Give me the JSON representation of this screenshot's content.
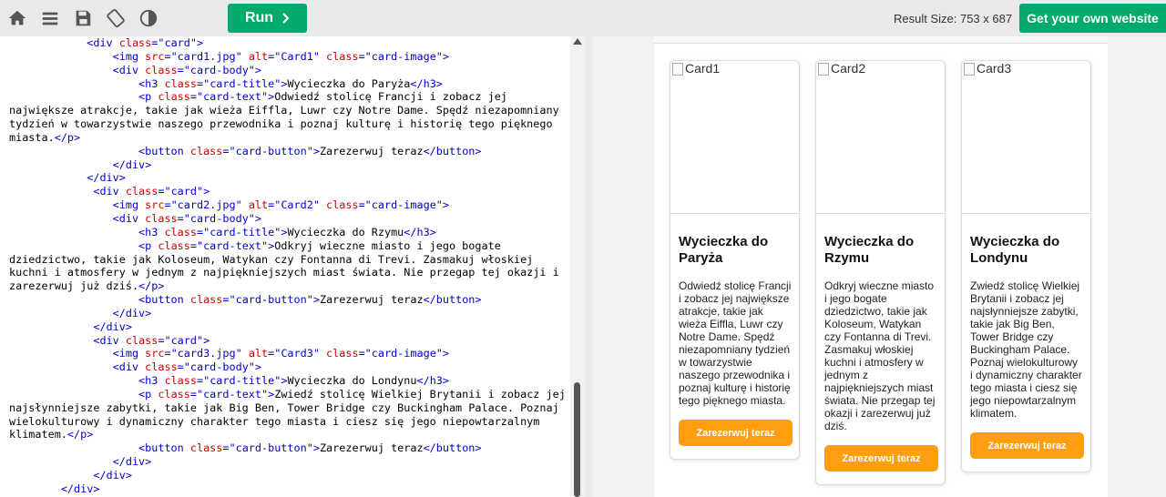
{
  "toolbar": {
    "run_label": "Run",
    "result_size_label": "Result Size: 753 x 687",
    "own_website_label": "Get your own website"
  },
  "editor": {
    "lines": [
      [
        {
          "t": "            ",
          "c": ""
        },
        {
          "t": "<div ",
          "c": "tag"
        },
        {
          "t": "class",
          "c": "attr"
        },
        {
          "t": "=\"card\"",
          "c": "val"
        },
        {
          "t": ">",
          "c": "tag"
        }
      ],
      [
        {
          "t": "                ",
          "c": ""
        },
        {
          "t": "<img ",
          "c": "tag"
        },
        {
          "t": "src",
          "c": "attr"
        },
        {
          "t": "=\"card1.jpg\" ",
          "c": "val"
        },
        {
          "t": "alt",
          "c": "attr"
        },
        {
          "t": "=\"Card1\" ",
          "c": "val"
        },
        {
          "t": "class",
          "c": "attr"
        },
        {
          "t": "=\"card-image\"",
          "c": "val"
        },
        {
          "t": ">",
          "c": "tag"
        }
      ],
      [
        {
          "t": "                ",
          "c": ""
        },
        {
          "t": "<div ",
          "c": "tag"
        },
        {
          "t": "class",
          "c": "attr"
        },
        {
          "t": "=\"card-body\"",
          "c": "val"
        },
        {
          "t": ">",
          "c": "tag"
        }
      ],
      [
        {
          "t": "                    ",
          "c": ""
        },
        {
          "t": "<h3 ",
          "c": "tag"
        },
        {
          "t": "class",
          "c": "attr"
        },
        {
          "t": "=\"card-title\"",
          "c": "val"
        },
        {
          "t": ">",
          "c": "tag"
        },
        {
          "t": "Wycieczka do Paryża",
          "c": ""
        },
        {
          "t": "</h3>",
          "c": "tag"
        }
      ],
      [
        {
          "t": "                    ",
          "c": ""
        },
        {
          "t": "<p ",
          "c": "tag"
        },
        {
          "t": "class",
          "c": "attr"
        },
        {
          "t": "=\"card-text\"",
          "c": "val"
        },
        {
          "t": ">",
          "c": "tag"
        },
        {
          "t": "Odwiedź stolicę Francji i zobacz jej",
          "c": ""
        }
      ],
      [
        {
          "t": "największe atrakcje, takie jak wieża Eiffla, Luwr czy Notre Dame. Spędź niezapomniany",
          "c": ""
        }
      ],
      [
        {
          "t": "tydzień w towarzystwie naszego przewodnika i poznaj kulturę i historię tego pięknego",
          "c": ""
        }
      ],
      [
        {
          "t": "miasta.",
          "c": ""
        },
        {
          "t": "</p>",
          "c": "tag"
        }
      ],
      [
        {
          "t": "                    ",
          "c": ""
        },
        {
          "t": "<button ",
          "c": "tag"
        },
        {
          "t": "class",
          "c": "attr"
        },
        {
          "t": "=\"card-button\"",
          "c": "val"
        },
        {
          "t": ">",
          "c": "tag"
        },
        {
          "t": "Zarezerwuj teraz",
          "c": ""
        },
        {
          "t": "</button>",
          "c": "tag"
        }
      ],
      [
        {
          "t": "                ",
          "c": ""
        },
        {
          "t": "</div>",
          "c": "tag"
        }
      ],
      [
        {
          "t": "            ",
          "c": ""
        },
        {
          "t": "</div>",
          "c": "tag"
        }
      ],
      [
        {
          "t": "             ",
          "c": ""
        },
        {
          "t": "<div ",
          "c": "tag"
        },
        {
          "t": "class",
          "c": "attr"
        },
        {
          "t": "=\"card\"",
          "c": "val"
        },
        {
          "t": ">",
          "c": "tag"
        }
      ],
      [
        {
          "t": "                ",
          "c": ""
        },
        {
          "t": "<img ",
          "c": "tag"
        },
        {
          "t": "src",
          "c": "attr"
        },
        {
          "t": "=\"card2.jpg\" ",
          "c": "val"
        },
        {
          "t": "alt",
          "c": "attr"
        },
        {
          "t": "=\"Card2\" ",
          "c": "val"
        },
        {
          "t": "class",
          "c": "attr"
        },
        {
          "t": "=\"card-image\"",
          "c": "val"
        },
        {
          "t": ">",
          "c": "tag"
        }
      ],
      [
        {
          "t": "                ",
          "c": ""
        },
        {
          "t": "<div ",
          "c": "tag"
        },
        {
          "t": "class",
          "c": "attr"
        },
        {
          "t": "=\"card-body\"",
          "c": "val"
        },
        {
          "t": ">",
          "c": "tag"
        }
      ],
      [
        {
          "t": "                    ",
          "c": ""
        },
        {
          "t": "<h3 ",
          "c": "tag"
        },
        {
          "t": "class",
          "c": "attr"
        },
        {
          "t": "=\"card-title\"",
          "c": "val"
        },
        {
          "t": ">",
          "c": "tag"
        },
        {
          "t": "Wycieczka do Rzymu",
          "c": ""
        },
        {
          "t": "</h3>",
          "c": "tag"
        }
      ],
      [
        {
          "t": "                    ",
          "c": ""
        },
        {
          "t": "<p ",
          "c": "tag"
        },
        {
          "t": "class",
          "c": "attr"
        },
        {
          "t": "=\"card-text\"",
          "c": "val"
        },
        {
          "t": ">",
          "c": "tag"
        },
        {
          "t": "Odkryj wieczne miasto i jego bogate",
          "c": ""
        }
      ],
      [
        {
          "t": "dziedzictwo, takie jak Koloseum, Watykan czy Fontanna di Trevi. Zasmakuj włoskiej",
          "c": ""
        }
      ],
      [
        {
          "t": "kuchni i atmosfery w jednym z najpiękniejszych miast świata. Nie przegap tej okazji i",
          "c": ""
        }
      ],
      [
        {
          "t": "zarezerwuj już dziś.",
          "c": ""
        },
        {
          "t": "</p>",
          "c": "tag"
        }
      ],
      [
        {
          "t": "                    ",
          "c": ""
        },
        {
          "t": "<button ",
          "c": "tag"
        },
        {
          "t": "class",
          "c": "attr"
        },
        {
          "t": "=\"card-button\"",
          "c": "val"
        },
        {
          "t": ">",
          "c": "tag"
        },
        {
          "t": "Zarezerwuj teraz",
          "c": ""
        },
        {
          "t": "</button>",
          "c": "tag"
        }
      ],
      [
        {
          "t": "                ",
          "c": ""
        },
        {
          "t": "</div>",
          "c": "tag"
        }
      ],
      [
        {
          "t": "             ",
          "c": ""
        },
        {
          "t": "</div>",
          "c": "tag"
        }
      ],
      [
        {
          "t": "             ",
          "c": ""
        },
        {
          "t": "<div ",
          "c": "tag"
        },
        {
          "t": "class",
          "c": "attr"
        },
        {
          "t": "=\"card\"",
          "c": "val"
        },
        {
          "t": ">",
          "c": "tag"
        }
      ],
      [
        {
          "t": "                ",
          "c": ""
        },
        {
          "t": "<img ",
          "c": "tag"
        },
        {
          "t": "src",
          "c": "attr"
        },
        {
          "t": "=\"card3.jpg\" ",
          "c": "val"
        },
        {
          "t": "alt",
          "c": "attr"
        },
        {
          "t": "=\"Card3\" ",
          "c": "val"
        },
        {
          "t": "class",
          "c": "attr"
        },
        {
          "t": "=\"card-image\"",
          "c": "val"
        },
        {
          "t": ">",
          "c": "tag"
        }
      ],
      [
        {
          "t": "                ",
          "c": ""
        },
        {
          "t": "<div ",
          "c": "tag"
        },
        {
          "t": "class",
          "c": "attr"
        },
        {
          "t": "=\"card-body\"",
          "c": "val"
        },
        {
          "t": ">",
          "c": "tag"
        }
      ],
      [
        {
          "t": "                    ",
          "c": ""
        },
        {
          "t": "<h3 ",
          "c": "tag"
        },
        {
          "t": "class",
          "c": "attr"
        },
        {
          "t": "=\"card-title\"",
          "c": "val"
        },
        {
          "t": ">",
          "c": "tag"
        },
        {
          "t": "Wycieczka do Londynu",
          "c": ""
        },
        {
          "t": "</h3>",
          "c": "tag"
        }
      ],
      [
        {
          "t": "                    ",
          "c": ""
        },
        {
          "t": "<p ",
          "c": "tag"
        },
        {
          "t": "class",
          "c": "attr"
        },
        {
          "t": "=\"card-text\"",
          "c": "val"
        },
        {
          "t": ">",
          "c": "tag"
        },
        {
          "t": "Zwiedź stolicę Wielkiej Brytanii i zobacz jej",
          "c": ""
        }
      ],
      [
        {
          "t": "najsłynniejsze zabytki, takie jak Big Ben, Tower Bridge czy Buckingham Palace. Poznaj",
          "c": ""
        }
      ],
      [
        {
          "t": "wielokulturowy i dynamiczny charakter tego miasta i ciesz się jego niepowtarzalnym",
          "c": ""
        }
      ],
      [
        {
          "t": "klimatem.",
          "c": ""
        },
        {
          "t": "</p>",
          "c": "tag"
        }
      ],
      [
        {
          "t": "                    ",
          "c": ""
        },
        {
          "t": "<button ",
          "c": "tag"
        },
        {
          "t": "class",
          "c": "attr"
        },
        {
          "t": "=\"card-button\"",
          "c": "val"
        },
        {
          "t": ">",
          "c": "tag"
        },
        {
          "t": "Zarezerwuj teraz",
          "c": ""
        },
        {
          "t": "</button>",
          "c": "tag"
        }
      ],
      [
        {
          "t": "                ",
          "c": ""
        },
        {
          "t": "</div>",
          "c": "tag"
        }
      ],
      [
        {
          "t": "             ",
          "c": ""
        },
        {
          "t": "</div>",
          "c": "tag"
        }
      ],
      [
        {
          "t": "        ",
          "c": ""
        },
        {
          "t": "</div>",
          "c": "tag"
        }
      ]
    ]
  },
  "cards": [
    {
      "alt": "Card1",
      "title": "Wycieczka do Paryża",
      "text": "Odwiedź stolicę Francji i zobacz jej największe atrakcje, takie jak wieża Eiffla, Luwr czy Notre Dame. Spędź niezapomniany tydzień w towarzystwie naszego przewodnika i poznaj kulturę i historię tego pięknego miasta.",
      "button": "Zarezerwuj teraz"
    },
    {
      "alt": "Card2",
      "title": "Wycieczka do Rzymu",
      "text": "Odkryj wieczne miasto i jego bogate dziedzictwo, takie jak Koloseum, Watykan czy Fontanna di Trevi. Zasmakuj włoskiej kuchni i atmosfery w jednym z najpiękniejszych miast świata. Nie przegap tej okazji i zarezerwuj już dziś.",
      "button": "Zarezerwuj teraz"
    },
    {
      "alt": "Card3",
      "title": "Wycieczka do Londynu",
      "text": "Zwiedź stolicę Wielkiej Brytanii i zobacz jej najsłynniejsze zabytki, takie jak Big Ben, Tower Bridge czy Buckingham Palace. Poznaj wielokulturowy i dynamiczny charakter tego miasta i ciesz się jego niepowtarzalnym klimatem.",
      "button": "Zarezerwuj teraz"
    }
  ],
  "colors": {
    "accent": "#04aa6d",
    "card_button": "#ff9f0f",
    "code_tag": "#0000cd",
    "code_attr": "#cd0000"
  }
}
